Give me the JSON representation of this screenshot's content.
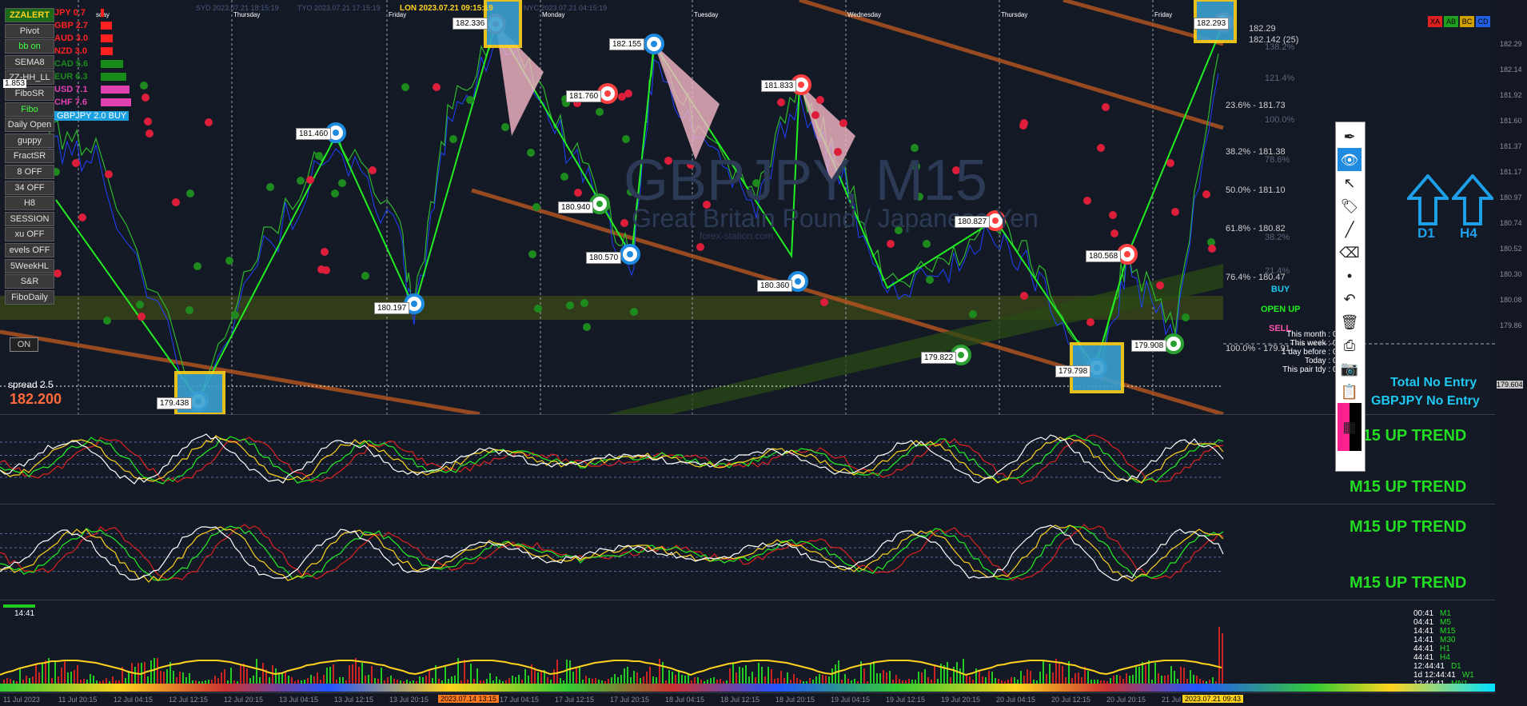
{
  "symbol": "GBPJPY",
  "watermark": {
    "title": "GBPJPY, M15",
    "subtitle": "Great Britain Pound / Japanese Yen",
    "site": "forex-station.com"
  },
  "sessions": [
    {
      "label": "SYD 2023.07.21 18:15:19"
    },
    {
      "label": "TYO 2023.07.21 17:15:19"
    },
    {
      "label": "LON 2023.07.21 09:15:19"
    },
    {
      "label": "NYC 2023.07.21 04:15:19"
    }
  ],
  "days": [
    "sday",
    "Thursday",
    "Friday",
    "Monday",
    "Tuesday",
    "Wednesday",
    "Thursday",
    "Friday"
  ],
  "left_buttons": [
    "ZZALERT",
    "Pivot",
    "bb on",
    "SEMA8",
    "ZZ-HH_LL",
    "FiboSR",
    "Fibo",
    "Daily Open",
    "guppy",
    "FractSR",
    "8 OFF",
    "34 OFF",
    "H8",
    "SESSION",
    "xu OFF",
    "evels OFF",
    "5WeekHL",
    "S&R",
    "FiboDaily"
  ],
  "currency_strength": [
    {
      "ccy": "JPY",
      "value": "0.7",
      "color": "#ff2020"
    },
    {
      "ccy": "GBP",
      "value": "2.7",
      "color": "#ff2020"
    },
    {
      "ccy": "AUD",
      "value": "3.0",
      "color": "#ff2020"
    },
    {
      "ccy": "NZD",
      "value": "3.0",
      "color": "#ff2020"
    },
    {
      "ccy": "CAD",
      "value": "5.6",
      "color": "#1a8a1a"
    },
    {
      "ccy": "EUR",
      "value": "6.3",
      "color": "#1a8a1a"
    },
    {
      "ccy": "USD",
      "value": "7.1",
      "color": "#e040b0"
    },
    {
      "ccy": "CHF",
      "value": "7.6",
      "color": "#e040b0"
    }
  ],
  "signal_badge": "GBPJPY 2.0 BUY",
  "spread": "spread 2.5",
  "bid": "182.200",
  "on_label": "ON",
  "left_price": "1.853",
  "price_labels": [
    "181.460",
    "180.197",
    "182.336",
    "182.155",
    "181.760",
    "180.940",
    "180.570",
    "181.833",
    "180.360",
    "180.827",
    "179.822",
    "180.568",
    "179.798",
    "179.908",
    "182.293",
    "179.438"
  ],
  "fibo_levels": [
    {
      "text": "182.29",
      "dim": false
    },
    {
      "text": "182.142 (25)",
      "dim": false
    },
    {
      "text": "138.2%",
      "dim": true
    },
    {
      "text": "121.4%",
      "dim": true
    },
    {
      "text": "23.6% - 181.73",
      "dim": false
    },
    {
      "text": "100.0%",
      "dim": true
    },
    {
      "text": "38.2% - 181.38",
      "dim": false
    },
    {
      "text": "78.6%",
      "dim": true
    },
    {
      "text": "50.0% - 181.10",
      "dim": false
    },
    {
      "text": "61.8% - 180.82",
      "dim": false
    },
    {
      "text": "38.2%",
      "dim": true
    },
    {
      "text": "21.4%",
      "dim": true
    },
    {
      "text": "76.4% - 180.47",
      "dim": false
    },
    {
      "text": "100.0% - 179.91",
      "dim": false
    }
  ],
  "signals": {
    "buy": "BUY",
    "open_up": "OPEN UP",
    "sell": "SELL"
  },
  "corner_buttons": [
    {
      "label": "XA",
      "color": "#dd2020"
    },
    {
      "label": "AB",
      "color": "#20a020"
    },
    {
      "label": "BC",
      "color": "#d0a000"
    },
    {
      "label": "CD",
      "color": "#2060e0"
    }
  ],
  "pips": [
    "This month : 0.0 pips",
    "This week : 0.0 pips",
    "1 day before : 0.0 pips",
    "Today : 0.0 pips",
    "This pair tdy : 0.0 pips"
  ],
  "entry": {
    "total": "Total No Entry",
    "pair": "GBPJPY No Entry"
  },
  "trends": [
    "M15 UP TREND",
    "M15 UP TREND",
    "M15 UP TREND",
    "M15 UP TREND"
  ],
  "big_arrows": [
    "D1",
    "H4"
  ],
  "timeframe_timers": [
    {
      "time": "00:41",
      "tf": "M1"
    },
    {
      "time": "04:41",
      "tf": "M5"
    },
    {
      "time": "14:41",
      "tf": "M15"
    },
    {
      "time": "14:41",
      "tf": "M30"
    },
    {
      "time": "44:41",
      "tf": "H1"
    },
    {
      "time": "44:41",
      "tf": "H4"
    },
    {
      "time": "12:44:41",
      "tf": "D1"
    },
    {
      "time": "1d 12:44:41",
      "tf": "W1"
    },
    {
      "time": "12:44:41",
      "tf": "MN1"
    }
  ],
  "bar_timer": "14:41",
  "bottom_highlight_left": "2023.07.14 13:15",
  "bottom_highlight_right": "2023.07.21 09:43",
  "x_labels": [
    "11 Jul 2023",
    "11 Jul 20:15",
    "12 Jul 04:15",
    "12 Jul 12:15",
    "12 Jul 20:15",
    "13 Jul 04:15",
    "13 Jul 12:15",
    "13 Jul 20:15",
    "14 Jul 04:15",
    "17 Jul 04:15",
    "17 Jul 12:15",
    "17 Jul 20:15",
    "18 Jul 04:15",
    "18 Jul 12:15",
    "18 Jul 20:15",
    "19 Jul 04:15",
    "19 Jul 12:15",
    "19 Jul 20:15",
    "20 Jul 04:15",
    "20 Jul 12:15",
    "20 Jul 20:15",
    "21 Jul 04:15"
  ],
  "right_axis": [
    "182.29",
    "182.14",
    "181.92",
    "181.60",
    "181.37",
    "181.17",
    "180.97",
    "180.74",
    "180.52",
    "180.30",
    "180.08",
    "179.86",
    "179.604"
  ],
  "toolbar": [
    "pen-icon",
    "eye-icon",
    "cursor-icon",
    "tag-icon",
    "line-icon",
    "eraser-icon",
    "dot-icon",
    "undo-icon",
    "trash-icon",
    "printer-icon",
    "camera-icon",
    "clipboard-icon",
    "color-palette-icon"
  ]
}
